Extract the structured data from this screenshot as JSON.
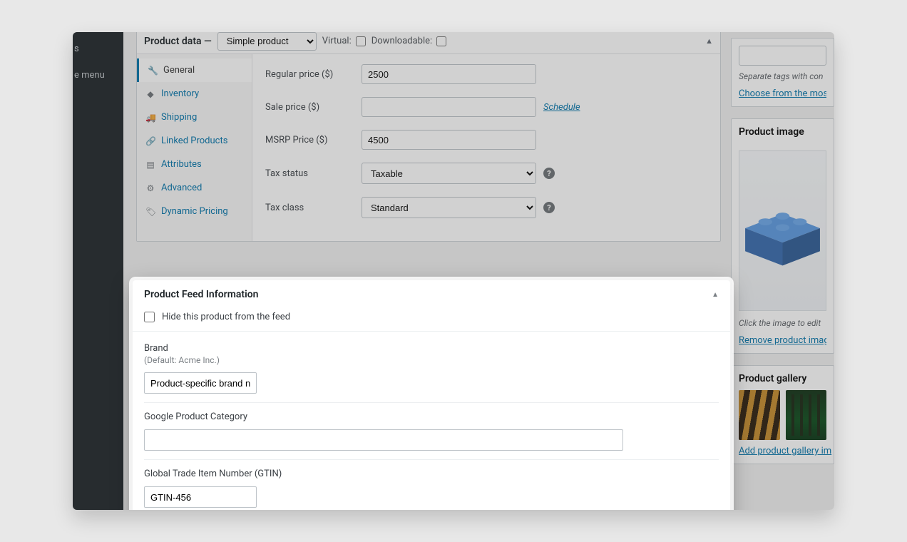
{
  "admin_sidebar": {
    "item_trunc_1": "s",
    "item_trunc_2": "e menu"
  },
  "product_data": {
    "header_label": "Product data —",
    "type_selected": "Simple product",
    "virtual_label": "Virtual:",
    "downloadable_label": "Downloadable:",
    "tabs": {
      "general": "General",
      "inventory": "Inventory",
      "shipping": "Shipping",
      "linked": "Linked Products",
      "attributes": "Attributes",
      "advanced": "Advanced",
      "dynamic": "Dynamic Pricing"
    },
    "fields": {
      "regular_price_label": "Regular price ($)",
      "regular_price_value": "2500",
      "sale_price_label": "Sale price ($)",
      "sale_price_value": "",
      "schedule_link": "Schedule",
      "msrp_label": "MSRP Price ($)",
      "msrp_value": "4500",
      "tax_status_label": "Tax status",
      "tax_status_value": "Taxable",
      "tax_class_label": "Tax class",
      "tax_class_value": "Standard"
    }
  },
  "feed_panel": {
    "title": "Product Feed Information",
    "hide_label": "Hide this product from the feed",
    "brand_label": "Brand",
    "brand_hint": "(Default: Acme Inc.)",
    "brand_value": "Product-specific brand n",
    "gpc_label": "Google Product Category",
    "gpc_value": "",
    "gtin_label": "Global Trade Item Number (GTIN)",
    "gtin_value": "GTIN-456"
  },
  "right": {
    "tags_hint": "Separate tags with con",
    "tags_link": "Choose from the most",
    "product_image_title": "Product image",
    "image_edit_hint": "Click the image to edit",
    "remove_image_link": "Remove product image",
    "gallery_title": "Product gallery",
    "add_gallery_link": "Add product gallery im"
  }
}
